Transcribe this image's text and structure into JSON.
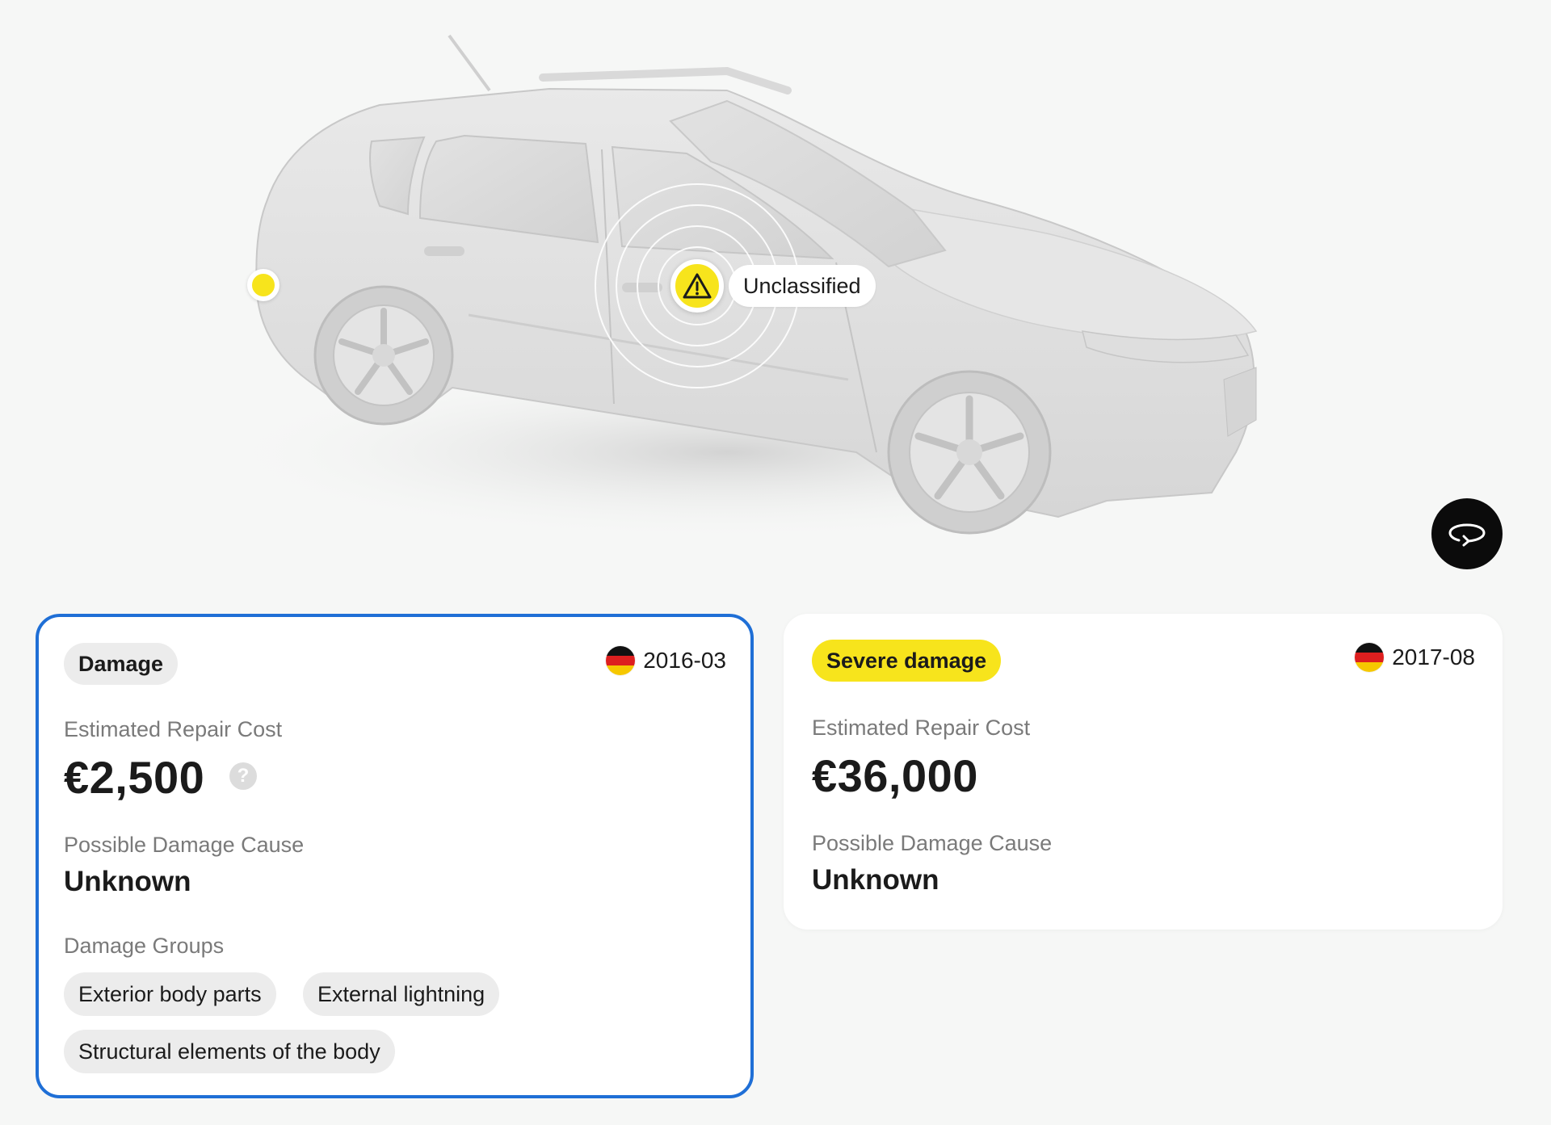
{
  "viewer": {
    "markers": [
      {
        "label": "Unclassified",
        "icon": "warning-icon",
        "color": "#f7e41c"
      }
    ],
    "rotate_icon": "rotate-360-icon"
  },
  "cards": [
    {
      "badge": "Damage",
      "badge_color": "#ececec",
      "country_flag": "germany-flag-icon",
      "date": "2016-03",
      "cost_label": "Estimated Repair Cost",
      "cost_value": "€2,500",
      "help_icon": "?",
      "cause_label": "Possible Damage Cause",
      "cause_value": "Unknown",
      "groups_label": "Damage Groups",
      "groups": [
        "Exterior body parts",
        "External lightning",
        "Structural elements of the body"
      ],
      "selected": true,
      "selected_border_color": "#1f6fd6"
    },
    {
      "badge": "Severe damage",
      "badge_color": "#f7e41c",
      "country_flag": "germany-flag-icon",
      "date": "2017-08",
      "cost_label": "Estimated Repair Cost",
      "cost_value": "€36,000",
      "cause_label": "Possible Damage Cause",
      "cause_value": "Unknown",
      "selected": false
    }
  ]
}
